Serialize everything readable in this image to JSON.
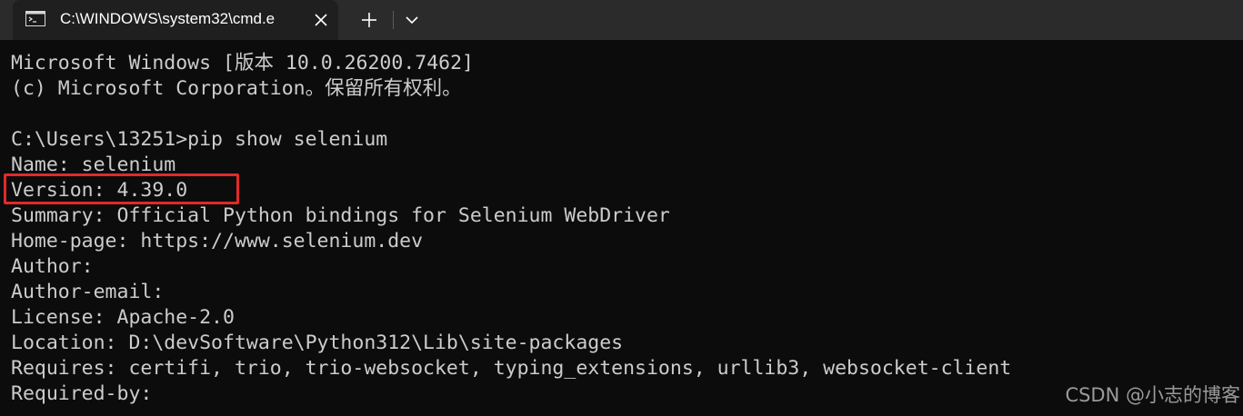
{
  "window": {
    "tab_title": "C:\\WINDOWS\\system32\\cmd.e",
    "icons": {
      "tab": "cmd-terminal-icon",
      "close": "close-icon",
      "new_tab": "plus-icon",
      "dropdown": "chevron-down-icon"
    }
  },
  "console": {
    "lines": [
      "Microsoft Windows [版本 10.0.26200.7462]",
      "(c) Microsoft Corporation。保留所有权利。",
      "",
      "C:\\Users\\13251>pip show selenium",
      "Name: selenium",
      "Version: 4.39.0",
      "Summary: Official Python bindings for Selenium WebDriver",
      "Home-page: https://www.selenium.dev",
      "Author:",
      "Author-email:",
      "License: Apache-2.0",
      "Location: D:\\devSoftware\\Python312\\Lib\\site-packages",
      "Requires: certifi, trio, trio-websocket, typing_extensions, urllib3, websocket-client",
      "Required-by:"
    ]
  },
  "watermark": "CSDN @小志的博客",
  "colors": {
    "background": "#0c0c0c",
    "text": "#cccccc",
    "highlight_border": "#e12a2a",
    "tab_active": "#1f1f1f",
    "tab_bar": "#2b2b2b"
  }
}
